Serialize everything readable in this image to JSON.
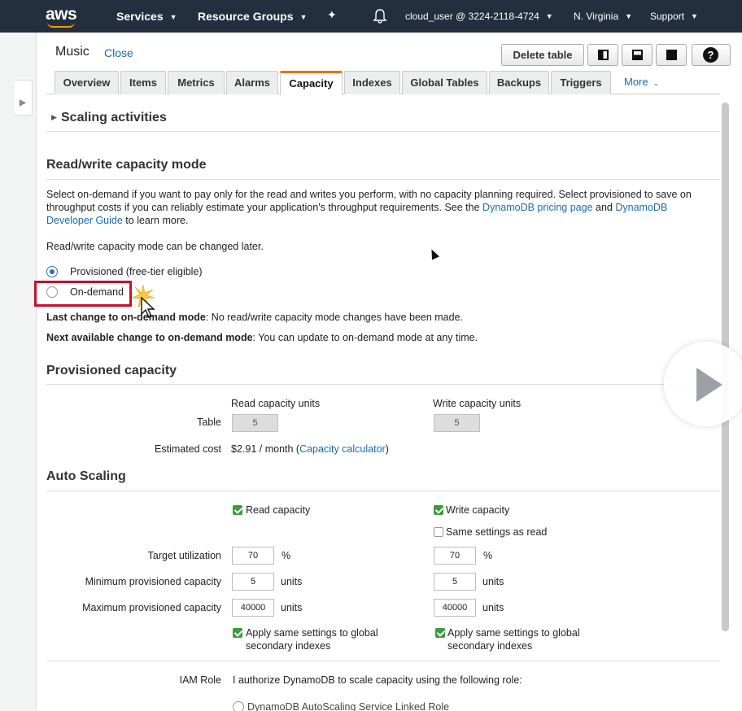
{
  "nav": {
    "logo": "aws",
    "services": "Services",
    "resource_groups": "Resource Groups",
    "account": "cloud_user @ 3224-2118-4724",
    "region": "N. Virginia",
    "support": "Support"
  },
  "header": {
    "table_name": "Music",
    "close": "Close",
    "delete_table": "Delete table",
    "help": "?"
  },
  "tabs": [
    {
      "label": "Overview"
    },
    {
      "label": "Items"
    },
    {
      "label": "Metrics"
    },
    {
      "label": "Alarms"
    },
    {
      "label": "Capacity",
      "active": true
    },
    {
      "label": "Indexes"
    },
    {
      "label": "Global Tables"
    },
    {
      "label": "Backups"
    },
    {
      "label": "Triggers"
    },
    {
      "label": "More"
    }
  ],
  "scaling_activities": "Scaling activities",
  "rw_mode": {
    "heading": "Read/write capacity mode",
    "desc_1": "Select on-demand if you want to pay only for the read and writes you perform, with no capacity planning required. Select provisioned to save on throughput costs if you can reliably estimate your application's throughput requirements. See the",
    "pricing_link": "DynamoDB pricing page",
    "and": "and",
    "guide_link": "DynamoDB Developer Guide",
    "learn_more": "to learn more.",
    "changeable": "Read/write capacity mode can be changed later.",
    "option_provisioned": "Provisioned (free-tier eligible)",
    "option_ondemand": "On-demand",
    "selected": "provisioned",
    "last_change_label": "Last change to on-demand mode",
    "last_change_value": ": No read/write capacity mode changes have been made.",
    "next_change_label": "Next available change to on-demand mode",
    "next_change_value": ": You can update to on-demand mode at any time."
  },
  "provisioned": {
    "heading": "Provisioned capacity",
    "read_header": "Read capacity units",
    "write_header": "Write capacity units",
    "table_label": "Table",
    "read_value": "5",
    "write_value": "5",
    "cost_label": "Estimated cost",
    "cost_value": "$2.91 / month (",
    "calculator_link": "Capacity calculator",
    "cost_close": ")"
  },
  "autoscaling": {
    "heading": "Auto Scaling",
    "read_capacity": "Read capacity",
    "write_capacity": "Write capacity",
    "same_as_read": "Same settings as read",
    "target_label": "Target utilization",
    "min_label": "Minimum provisioned capacity",
    "max_label": "Maximum provisioned capacity",
    "read_target": "70",
    "write_target": "70",
    "percent": "%",
    "read_min": "5",
    "write_min": "5",
    "read_max": "40000",
    "write_max": "40000",
    "units": "units",
    "apply_global_1": "Apply same settings to global",
    "apply_global_2": "secondary indexes",
    "iam_label": "IAM Role",
    "iam_text": "I authorize DynamoDB to scale capacity using the following role:",
    "iam_option_partial": "DynamoDB AutoScaling Service Linked Role"
  }
}
